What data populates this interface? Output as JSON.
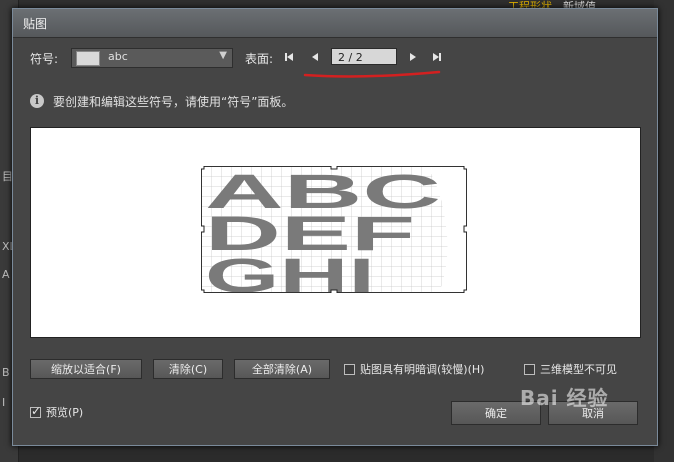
{
  "background": {
    "top_link": "工程形状",
    "top_text": "新域值",
    "left_letters": [
      "目",
      "XL",
      "A",
      "B",
      "I"
    ]
  },
  "dialog": {
    "title": "贴图",
    "symbol_label": "符号:",
    "symbol_value": "abc",
    "surface_label": "表面:",
    "page_value": "2 / 2",
    "info_text": "要创建和编辑这些符号，请使用“符号”面板。",
    "art_text": {
      "line1": "ABC",
      "line2": "DEF",
      "line3": "GHI"
    },
    "buttons": {
      "fit": "缩放以适合(F)",
      "clear": "清除(C)",
      "clear_all": "全部清除(A)",
      "ok": "确定",
      "cancel": "取消"
    },
    "checkboxes": {
      "shade": {
        "label": "贴图具有明暗调(较慢)(H)",
        "checked": false
      },
      "invisible": {
        "label": "三维模型不可见",
        "checked": false
      },
      "preview": {
        "label": "预览(P)",
        "checked": true
      }
    }
  },
  "watermark": "Bai 经验",
  "colors": {
    "dialog_bg": "#454545",
    "annotation_red": "#d32020",
    "art_gray": "#7a7a7a"
  }
}
